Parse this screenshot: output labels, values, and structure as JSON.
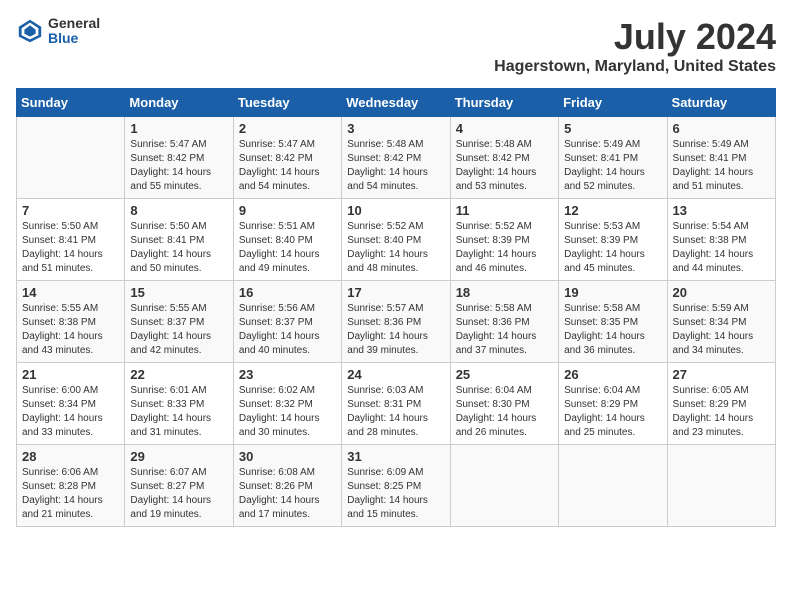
{
  "header": {
    "logo_line1": "General",
    "logo_line2": "Blue",
    "month_title": "July 2024",
    "location": "Hagerstown, Maryland, United States"
  },
  "weekdays": [
    "Sunday",
    "Monday",
    "Tuesday",
    "Wednesday",
    "Thursday",
    "Friday",
    "Saturday"
  ],
  "weeks": [
    [
      null,
      {
        "day": "1",
        "sunrise": "5:47 AM",
        "sunset": "8:42 PM",
        "daylight": "14 hours and 55 minutes."
      },
      {
        "day": "2",
        "sunrise": "5:47 AM",
        "sunset": "8:42 PM",
        "daylight": "14 hours and 54 minutes."
      },
      {
        "day": "3",
        "sunrise": "5:48 AM",
        "sunset": "8:42 PM",
        "daylight": "14 hours and 54 minutes."
      },
      {
        "day": "4",
        "sunrise": "5:48 AM",
        "sunset": "8:42 PM",
        "daylight": "14 hours and 53 minutes."
      },
      {
        "day": "5",
        "sunrise": "5:49 AM",
        "sunset": "8:41 PM",
        "daylight": "14 hours and 52 minutes."
      },
      {
        "day": "6",
        "sunrise": "5:49 AM",
        "sunset": "8:41 PM",
        "daylight": "14 hours and 51 minutes."
      }
    ],
    [
      {
        "day": "7",
        "sunrise": "5:50 AM",
        "sunset": "8:41 PM",
        "daylight": "14 hours and 51 minutes."
      },
      {
        "day": "8",
        "sunrise": "5:50 AM",
        "sunset": "8:41 PM",
        "daylight": "14 hours and 50 minutes."
      },
      {
        "day": "9",
        "sunrise": "5:51 AM",
        "sunset": "8:40 PM",
        "daylight": "14 hours and 49 minutes."
      },
      {
        "day": "10",
        "sunrise": "5:52 AM",
        "sunset": "8:40 PM",
        "daylight": "14 hours and 48 minutes."
      },
      {
        "day": "11",
        "sunrise": "5:52 AM",
        "sunset": "8:39 PM",
        "daylight": "14 hours and 46 minutes."
      },
      {
        "day": "12",
        "sunrise": "5:53 AM",
        "sunset": "8:39 PM",
        "daylight": "14 hours and 45 minutes."
      },
      {
        "day": "13",
        "sunrise": "5:54 AM",
        "sunset": "8:38 PM",
        "daylight": "14 hours and 44 minutes."
      }
    ],
    [
      {
        "day": "14",
        "sunrise": "5:55 AM",
        "sunset": "8:38 PM",
        "daylight": "14 hours and 43 minutes."
      },
      {
        "day": "15",
        "sunrise": "5:55 AM",
        "sunset": "8:37 PM",
        "daylight": "14 hours and 42 minutes."
      },
      {
        "day": "16",
        "sunrise": "5:56 AM",
        "sunset": "8:37 PM",
        "daylight": "14 hours and 40 minutes."
      },
      {
        "day": "17",
        "sunrise": "5:57 AM",
        "sunset": "8:36 PM",
        "daylight": "14 hours and 39 minutes."
      },
      {
        "day": "18",
        "sunrise": "5:58 AM",
        "sunset": "8:36 PM",
        "daylight": "14 hours and 37 minutes."
      },
      {
        "day": "19",
        "sunrise": "5:58 AM",
        "sunset": "8:35 PM",
        "daylight": "14 hours and 36 minutes."
      },
      {
        "day": "20",
        "sunrise": "5:59 AM",
        "sunset": "8:34 PM",
        "daylight": "14 hours and 34 minutes."
      }
    ],
    [
      {
        "day": "21",
        "sunrise": "6:00 AM",
        "sunset": "8:34 PM",
        "daylight": "14 hours and 33 minutes."
      },
      {
        "day": "22",
        "sunrise": "6:01 AM",
        "sunset": "8:33 PM",
        "daylight": "14 hours and 31 minutes."
      },
      {
        "day": "23",
        "sunrise": "6:02 AM",
        "sunset": "8:32 PM",
        "daylight": "14 hours and 30 minutes."
      },
      {
        "day": "24",
        "sunrise": "6:03 AM",
        "sunset": "8:31 PM",
        "daylight": "14 hours and 28 minutes."
      },
      {
        "day": "25",
        "sunrise": "6:04 AM",
        "sunset": "8:30 PM",
        "daylight": "14 hours and 26 minutes."
      },
      {
        "day": "26",
        "sunrise": "6:04 AM",
        "sunset": "8:29 PM",
        "daylight": "14 hours and 25 minutes."
      },
      {
        "day": "27",
        "sunrise": "6:05 AM",
        "sunset": "8:29 PM",
        "daylight": "14 hours and 23 minutes."
      }
    ],
    [
      {
        "day": "28",
        "sunrise": "6:06 AM",
        "sunset": "8:28 PM",
        "daylight": "14 hours and 21 minutes."
      },
      {
        "day": "29",
        "sunrise": "6:07 AM",
        "sunset": "8:27 PM",
        "daylight": "14 hours and 19 minutes."
      },
      {
        "day": "30",
        "sunrise": "6:08 AM",
        "sunset": "8:26 PM",
        "daylight": "14 hours and 17 minutes."
      },
      {
        "day": "31",
        "sunrise": "6:09 AM",
        "sunset": "8:25 PM",
        "daylight": "14 hours and 15 minutes."
      },
      null,
      null,
      null
    ]
  ]
}
